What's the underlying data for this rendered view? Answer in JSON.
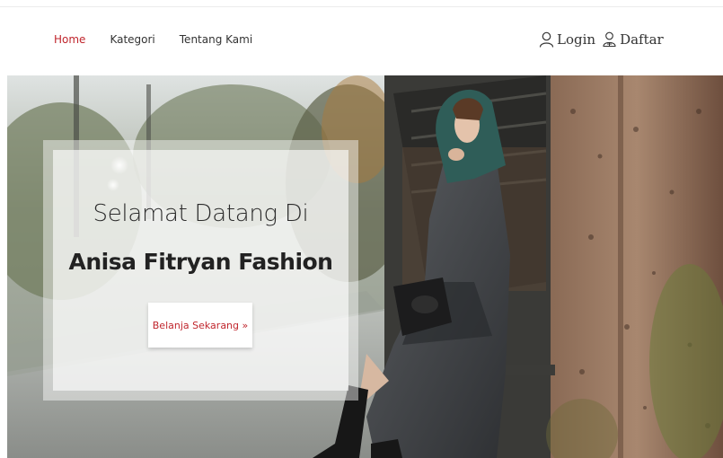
{
  "nav": {
    "items": [
      {
        "label": "Home",
        "active": true
      },
      {
        "label": "Kategori",
        "active": false
      },
      {
        "label": "Tentang Kami",
        "active": false
      }
    ],
    "login_label": "Login",
    "register_label": "Daftar",
    "login_icon": "user-outline-icon",
    "register_icon": "user-add-icon"
  },
  "hero": {
    "welcome_text": "Selamat Datang Di",
    "brand_text": "Anisa Fitryan Fashion",
    "cta_label": "Belanja Sekarang »"
  },
  "colors": {
    "accent": "#c0262d",
    "text": "#333333"
  }
}
